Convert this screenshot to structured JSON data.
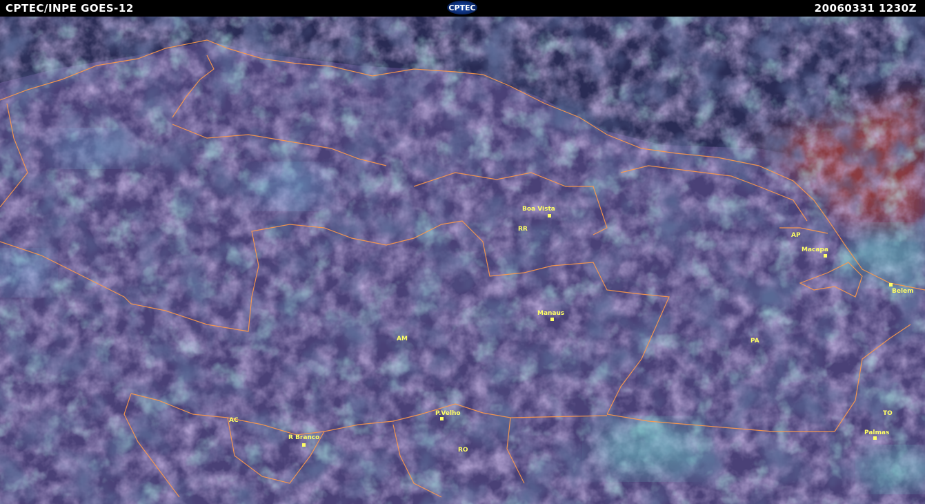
{
  "header": {
    "title": "CPTEC/INPE  GOES-12",
    "logo_text": "CPTEC",
    "timestamp": "20060331  1230Z"
  },
  "map": {
    "state_labels": {
      "rr": "RR",
      "ap": "AP",
      "am": "AM",
      "pa": "PA",
      "ac": "AC",
      "ro": "RO",
      "to": "TO"
    },
    "cities": {
      "boa_vista": "Boa Vista",
      "macapa": "Macapa",
      "belem": "Belem",
      "manaus": "Manaus",
      "p_velho": "P.Velho",
      "r_branco": "R Branco",
      "palmas": "Palmas"
    },
    "colors": {
      "border": "#ff9a4a",
      "label": "#ffff66",
      "ocean": "#8a3a40",
      "cloud": "#6fd8d0"
    }
  }
}
